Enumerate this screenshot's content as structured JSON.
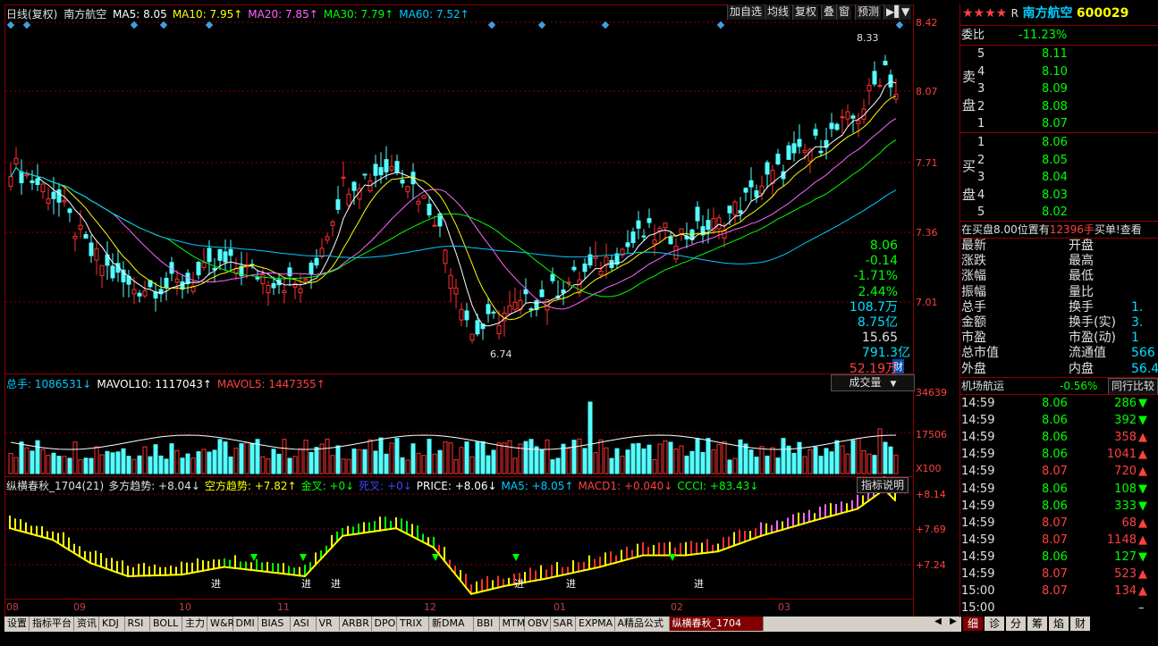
{
  "main_chart": {
    "period_label": "日线(复权)",
    "stock_name": "南方航空",
    "ma": [
      {
        "label": "MA5: 8.05",
        "color": "#ffffff"
      },
      {
        "label": "MA10: 7.95↑",
        "color": "#ffff00"
      },
      {
        "label": "MA20: 7.85↑",
        "color": "#ff66ff"
      },
      {
        "label": "MA30: 7.79↑",
        "color": "#00ff00"
      },
      {
        "label": "MA60: 7.52↑",
        "color": "#00ccff"
      }
    ],
    "buttons": [
      "加自选",
      "均线",
      "复权",
      "叠",
      "窗",
      "预测"
    ],
    "y_ticks": [
      "8.42",
      "8.07",
      "7.71",
      "7.36",
      "7.01"
    ],
    "high_mark": "8.33",
    "low_mark": "6.74",
    "cai_label": "财"
  },
  "volume_chart": {
    "legend": [
      {
        "label": "总手: 1086531↓",
        "color": "#00ccff"
      },
      {
        "label": "MAVOL10: 1117043↑",
        "color": "#ffffff"
      },
      {
        "label": "MAVOL5: 1447355↑",
        "color": "#ff4040"
      }
    ],
    "dropdown": "成交量",
    "y_ticks": [
      "34639",
      "17506",
      "X100"
    ]
  },
  "indicator_chart": {
    "legend": [
      {
        "label": "纵横春秋_1704(21)",
        "color": "#e0e0e0"
      },
      {
        "label": "多方趋势: +8.04↓",
        "color": "#e0e0e0"
      },
      {
        "label": "空方趋势: +7.82↑",
        "color": "#ffff00"
      },
      {
        "label": "金叉: +0↓",
        "color": "#00ff00"
      },
      {
        "label": "死叉: +0↓",
        "color": "#4040ff"
      },
      {
        "label": "PRICE: +8.06↓",
        "color": "#ffffff"
      },
      {
        "label": "MA5: +8.05↑",
        "color": "#00ccff"
      },
      {
        "label": "MACD1: +0.040↓",
        "color": "#ff4040"
      },
      {
        "label": "CCCI: +83.43↓",
        "color": "#00ff00"
      }
    ],
    "help_button": "指标说明",
    "y_ticks": [
      "+8.14",
      "+7.69",
      "+7.24"
    ],
    "signal_label": "进"
  },
  "x_axis": [
    "08",
    "09",
    "10",
    "11",
    "12",
    "01",
    "02",
    "03"
  ],
  "tabs": [
    "设置",
    "指标平台",
    "资讯",
    "KDJ",
    "RSI",
    "BOLL",
    "主力",
    "W&R",
    "DMI",
    "BIAS",
    "ASI",
    "VR",
    "ARBR",
    "DPO",
    "TRIX",
    "新DMA",
    "BBI",
    "MTM",
    "OBV",
    "SAR",
    "EXPMA",
    "A精品公式",
    "纵横春秋_1704"
  ],
  "quote_panel": {
    "rating": "★★★★",
    "r_mark": "R",
    "name": "南方航空",
    "code": "600029",
    "weibi_label": "委比",
    "weibi_value": "-11.23%",
    "sell_label_1": "卖",
    "sell_label_2": "盘",
    "buy_label_1": "买",
    "buy_label_2": "盘",
    "sell": [
      {
        "level": "5",
        "price": "8.11"
      },
      {
        "level": "4",
        "price": "8.10"
      },
      {
        "level": "3",
        "price": "8.09"
      },
      {
        "level": "2",
        "price": "8.08"
      },
      {
        "level": "1",
        "price": "8.07"
      }
    ],
    "buy": [
      {
        "level": "1",
        "price": "8.06"
      },
      {
        "level": "2",
        "price": "8.05"
      },
      {
        "level": "3",
        "price": "8.04"
      },
      {
        "level": "4",
        "price": "8.03"
      },
      {
        "level": "5",
        "price": "8.02"
      }
    ],
    "notice_a": "在买盘8.00位置有",
    "notice_b": "12396手",
    "notice_c": "买单!",
    "notice_d": "查看",
    "stats": [
      {
        "k": "最新",
        "v": "8.06",
        "k2": "开盘",
        "vc": "green"
      },
      {
        "k": "涨跌",
        "v": "-0.14",
        "k2": "最高",
        "vc": "green"
      },
      {
        "k": "涨幅",
        "v": "-1.71%",
        "k2": "最低",
        "vc": "green"
      },
      {
        "k": "振幅",
        "v": "2.44%",
        "k2": "量比",
        "vc": "green"
      },
      {
        "k": "总手",
        "v": "108.7万",
        "k2": "换手",
        "vc": "cyan",
        "v2": "1."
      },
      {
        "k": "金额",
        "v": "8.75亿",
        "k2": "换手(实)",
        "vc": "cyan",
        "v2": "3."
      },
      {
        "k": "市盈",
        "v": "15.65",
        "k2": "市盈(动)",
        "vc": "white",
        "v2": "1"
      },
      {
        "k": "总市值",
        "v": "791.3亿",
        "k2": "流通值",
        "vc": "cyan",
        "v2": "566"
      },
      {
        "k": "外盘",
        "v": "52.19万",
        "k2": "内盘",
        "vc": "red",
        "v2": "56.4"
      }
    ],
    "sector_name": "机场航运",
    "sector_change": "-0.56%",
    "sector_btn": "同行比较",
    "ticks": [
      {
        "t": "14:59",
        "p": "8.06",
        "v": "286",
        "d": "down"
      },
      {
        "t": "14:59",
        "p": "8.06",
        "v": "392",
        "d": "down"
      },
      {
        "t": "14:59",
        "p": "8.06",
        "v": "358",
        "d": "up"
      },
      {
        "t": "14:59",
        "p": "8.06",
        "v": "1041",
        "d": "up"
      },
      {
        "t": "14:59",
        "p": "8.07",
        "v": "720",
        "d": "up"
      },
      {
        "t": "14:59",
        "p": "8.06",
        "v": "108",
        "d": "down"
      },
      {
        "t": "14:59",
        "p": "8.06",
        "v": "333",
        "d": "down"
      },
      {
        "t": "14:59",
        "p": "8.07",
        "v": "68",
        "d": "up"
      },
      {
        "t": "14:59",
        "p": "8.07",
        "v": "1148",
        "d": "up"
      },
      {
        "t": "14:59",
        "p": "8.06",
        "v": "127",
        "d": "down"
      },
      {
        "t": "14:59",
        "p": "8.07",
        "v": "523",
        "d": "up"
      },
      {
        "t": "15:00",
        "p": "8.07",
        "v": "134",
        "d": "up"
      },
      {
        "t": "15:00",
        "p": "",
        "v": "",
        "d": "dash"
      }
    ],
    "bottom_tabs": [
      "细",
      "诊",
      "分",
      "筹",
      "焰",
      "财"
    ]
  }
}
